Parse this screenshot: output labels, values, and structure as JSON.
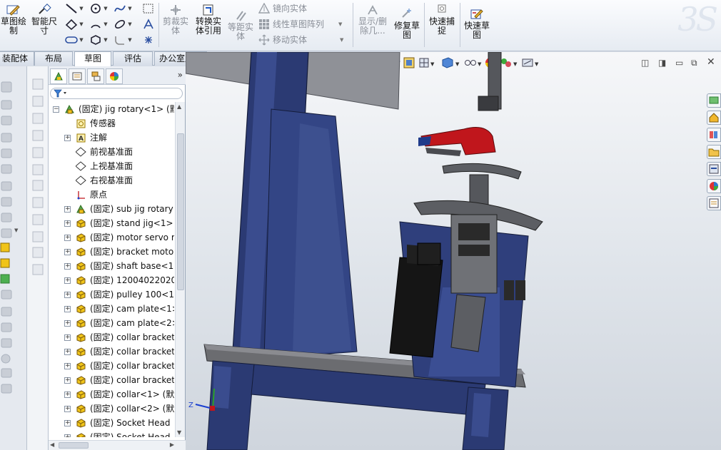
{
  "ribbon": {
    "sketch_label": "草图绘\n制",
    "smart_dim_label": "智能尺\n寸",
    "trim_label": "剪裁实\n体",
    "convert_label": "转换实\n体引用",
    "offset_label": "等距实\n体",
    "mirror_label": "镜向实体",
    "linear_pattern_label": "线性草图阵列",
    "move_label": "移动实体",
    "show_delete_label": "显示/删\n除几...",
    "repair_label": "修复草\n图",
    "quick_snap_label": "快速捕\n捉",
    "rapid_sketch_label": "快速草\n图"
  },
  "tabs": [
    {
      "label": "装配体"
    },
    {
      "label": "布局"
    },
    {
      "label": "草图"
    },
    {
      "label": "评估"
    },
    {
      "label": "办公室产品"
    }
  ],
  "tree": {
    "items": [
      {
        "label": "(固定) jig rotary<1> (默",
        "icon": "assembly-icon",
        "level": 0,
        "expander": "−"
      },
      {
        "label": "传感器",
        "icon": "sensor-icon",
        "level": 1,
        "expander": ""
      },
      {
        "label": "注解",
        "icon": "annotation-icon",
        "level": 1,
        "expander": "+"
      },
      {
        "label": "前视基准面",
        "icon": "plane-icon",
        "level": 1,
        "expander": ""
      },
      {
        "label": "上视基准面",
        "icon": "plane-icon",
        "level": 1,
        "expander": ""
      },
      {
        "label": "右视基准面",
        "icon": "plane-icon",
        "level": 1,
        "expander": ""
      },
      {
        "label": "原点",
        "icon": "origin-icon",
        "level": 1,
        "expander": ""
      },
      {
        "label": "(固定) sub jig rotary",
        "icon": "subassembly-icon",
        "level": 1,
        "expander": "+"
      },
      {
        "label": "(固定) stand jig<1>",
        "icon": "part-icon",
        "level": 1,
        "expander": "+"
      },
      {
        "label": "(固定) motor servo r",
        "icon": "part-icon",
        "level": 1,
        "expander": "+"
      },
      {
        "label": "(固定) bracket moto",
        "icon": "part-icon",
        "level": 1,
        "expander": "+"
      },
      {
        "label": "(固定) shaft base<1:",
        "icon": "part-icon",
        "level": 1,
        "expander": "+"
      },
      {
        "label": "(固定) 12004022020-",
        "icon": "part-icon",
        "level": 1,
        "expander": "+"
      },
      {
        "label": "(固定) pulley 100<1>",
        "icon": "part-icon",
        "level": 1,
        "expander": "+"
      },
      {
        "label": "(固定) cam plate<1>",
        "icon": "part-icon",
        "level": 1,
        "expander": "+"
      },
      {
        "label": "(固定) cam plate<2>",
        "icon": "part-icon",
        "level": 1,
        "expander": "+"
      },
      {
        "label": "(固定) collar bracket",
        "icon": "part-icon",
        "level": 1,
        "expander": "+"
      },
      {
        "label": "(固定) collar bracket",
        "icon": "part-icon",
        "level": 1,
        "expander": "+"
      },
      {
        "label": "(固定) collar bracket",
        "icon": "part-icon",
        "level": 1,
        "expander": "+"
      },
      {
        "label": "(固定) collar bracket",
        "icon": "part-icon",
        "level": 1,
        "expander": "+"
      },
      {
        "label": "(固定) collar<1> (默认",
        "icon": "part-icon",
        "level": 1,
        "expander": "+"
      },
      {
        "label": "(固定) collar<2> (默认",
        "icon": "part-icon",
        "level": 1,
        "expander": "+"
      },
      {
        "label": "(固定) Socket Head",
        "icon": "part-icon",
        "level": 1,
        "expander": "+"
      },
      {
        "label": "(固定) Socket Head",
        "icon": "part-icon",
        "level": 1,
        "expander": "+"
      }
    ]
  },
  "viewport": {
    "triad_x_label": "Z",
    "model_colors": {
      "frame": "#2b3a73",
      "plate": "#4a4a52",
      "motor": "#111111",
      "clamp": "#c0161c",
      "background": "#e3e7ec"
    }
  }
}
